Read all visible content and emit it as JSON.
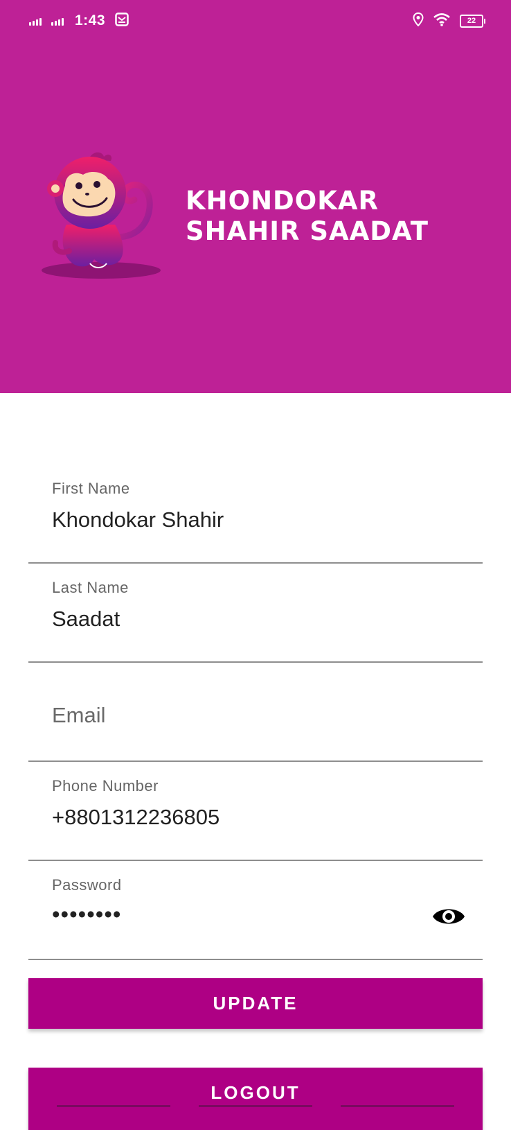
{
  "status_bar": {
    "time": "1:43",
    "battery": "22",
    "icons": [
      "signal-icon",
      "signal-icon",
      "mail-icon",
      "location-icon",
      "wifi-icon",
      "battery-icon"
    ]
  },
  "header": {
    "brand_name": "KHONDOKAR SHAHIR SAADAT",
    "logo": "monkey-mascot",
    "background_color": "#be2196"
  },
  "form": {
    "first_name": {
      "label": "First Name",
      "value": "Khondokar Shahir"
    },
    "last_name": {
      "label": "Last Name",
      "value": "Saadat"
    },
    "email": {
      "placeholder": "Email"
    },
    "phone": {
      "label": "Phone Number",
      "value": "+8801312236805"
    },
    "password": {
      "label": "Password",
      "value": "••••••••"
    }
  },
  "buttons": {
    "update_label": "UPDATE",
    "logout_label": "LOGOUT",
    "color": "#ae0084"
  }
}
